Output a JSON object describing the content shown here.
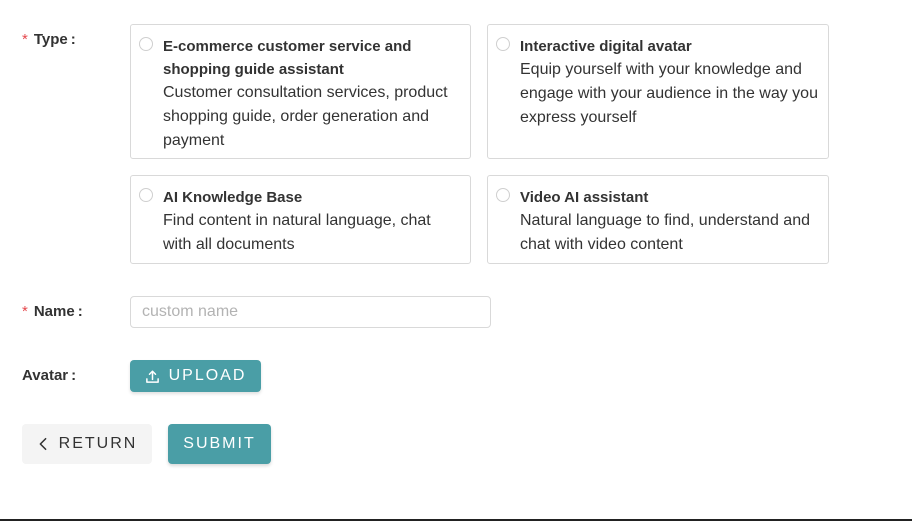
{
  "colors": {
    "primary": "#4a9ea6",
    "required": "#e5484d",
    "border": "#d9d9d9",
    "secondary_button_bg": "#f4f4f4"
  },
  "form": {
    "type_label": "Type",
    "name_label": "Name",
    "avatar_label": "Avatar",
    "colon": ":",
    "required_mark": "*"
  },
  "type_options": [
    {
      "title": "E-commerce customer service and shopping guide assistant",
      "description": "Customer consultation services, product shopping guide, order generation and payment",
      "selected": false
    },
    {
      "title": "Interactive digital avatar",
      "description": "Equip yourself with your knowledge and engage with your audience in the way you express yourself",
      "selected": false
    },
    {
      "title": "AI Knowledge Base",
      "description": "Find content in natural language, chat with all documents",
      "selected": false
    },
    {
      "title": "Video AI assistant",
      "description": "Natural language to find, understand and chat with video content",
      "selected": false
    }
  ],
  "name_input": {
    "value": "",
    "placeholder": "custom name"
  },
  "upload_button": {
    "label": "UPLOAD",
    "icon": "upload-icon"
  },
  "actions": {
    "return_label": "RETURN",
    "return_icon": "chevron-left-icon",
    "submit_label": "SUBMIT"
  }
}
